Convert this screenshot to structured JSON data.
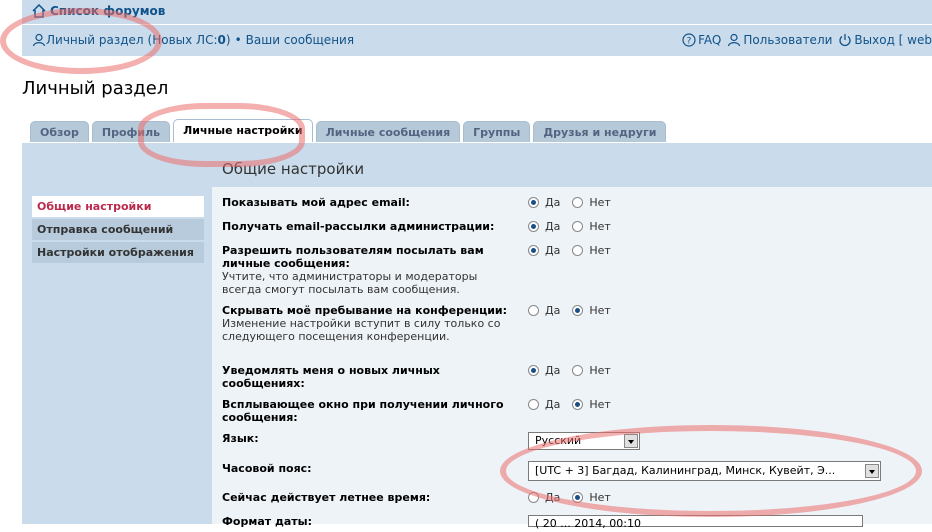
{
  "header": {
    "forum_list": "Список форумов",
    "ucp_link": "Личный раздел",
    "pm_prefix": "(Новых ЛС: ",
    "pm_count": "0",
    "pm_suffix": ")",
    "dot": "•",
    "your_posts": "Ваши сообщения",
    "faq": "FAQ",
    "users": "Пользователи",
    "logout": "Выход [ web"
  },
  "page_title": "Личный раздел",
  "tabs": [
    "Обзор",
    "Профиль",
    "Личные настройки",
    "Личные сообщения",
    "Группы",
    "Друзья и недруги"
  ],
  "active_tab": 2,
  "section_title": "Общие настройки",
  "sidebar": [
    "Общие настройки",
    "Отправка сообщений",
    "Настройки отображения"
  ],
  "yes": "Да",
  "no": "Нет",
  "settings": [
    {
      "label": "Показывать мой адрес email:",
      "note": "",
      "value": "yes"
    },
    {
      "label": "Получать email-рассылки администрации:",
      "note": "",
      "value": "yes"
    },
    {
      "label": "Разрешить пользователям посылать вам личные сообщения:",
      "note": "Учтите, что администраторы и модераторы всегда смогут посылать вам сообщения.",
      "value": "yes"
    },
    {
      "label": "Скрывать моё пребывание на конференции:",
      "note": "Изменение настройки вступит в силу только со следующего посещения конференции.",
      "value": "no"
    },
    {
      "label": "Уведомлять меня о новых личных сообщениях:",
      "note": "",
      "value": "yes"
    },
    {
      "label": "Всплывающее окно при получении личного сообщения:",
      "note": "",
      "value": "no"
    },
    {
      "label": "Сейчас действует летнее время:",
      "note": "",
      "value": "no"
    }
  ],
  "language": {
    "label": "Язык:",
    "value": "Русский"
  },
  "timezone": {
    "label": "Часовой пояс:",
    "value": "[UTC + 3] Багдад, Калининград, Минск, Кувейт, Э..."
  },
  "date_format": {
    "label": "Формат даты:",
    "value": "( 20 ... 2014, 00:10"
  },
  "colors": {
    "header_bg": "#cadceb",
    "link": "#105289",
    "active_nav": "#bc2a4d",
    "annotation": "#eb6e6e"
  }
}
